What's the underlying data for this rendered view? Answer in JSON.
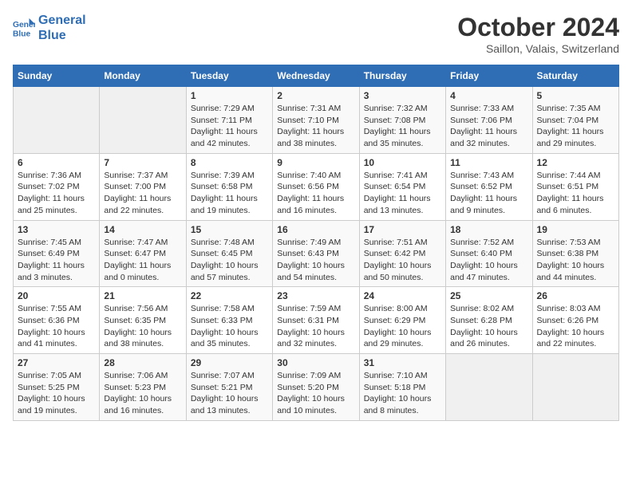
{
  "header": {
    "logo_line1": "General",
    "logo_line2": "Blue",
    "month": "October 2024",
    "location": "Saillon, Valais, Switzerland"
  },
  "weekdays": [
    "Sunday",
    "Monday",
    "Tuesday",
    "Wednesday",
    "Thursday",
    "Friday",
    "Saturday"
  ],
  "weeks": [
    [
      {
        "day": "",
        "empty": true
      },
      {
        "day": "",
        "empty": true
      },
      {
        "day": "1",
        "sunrise": "7:29 AM",
        "sunset": "7:11 PM",
        "daylight": "11 hours and 42 minutes."
      },
      {
        "day": "2",
        "sunrise": "7:31 AM",
        "sunset": "7:10 PM",
        "daylight": "11 hours and 38 minutes."
      },
      {
        "day": "3",
        "sunrise": "7:32 AM",
        "sunset": "7:08 PM",
        "daylight": "11 hours and 35 minutes."
      },
      {
        "day": "4",
        "sunrise": "7:33 AM",
        "sunset": "7:06 PM",
        "daylight": "11 hours and 32 minutes."
      },
      {
        "day": "5",
        "sunrise": "7:35 AM",
        "sunset": "7:04 PM",
        "daylight": "11 hours and 29 minutes."
      }
    ],
    [
      {
        "day": "6",
        "sunrise": "7:36 AM",
        "sunset": "7:02 PM",
        "daylight": "11 hours and 25 minutes."
      },
      {
        "day": "7",
        "sunrise": "7:37 AM",
        "sunset": "7:00 PM",
        "daylight": "11 hours and 22 minutes."
      },
      {
        "day": "8",
        "sunrise": "7:39 AM",
        "sunset": "6:58 PM",
        "daylight": "11 hours and 19 minutes."
      },
      {
        "day": "9",
        "sunrise": "7:40 AM",
        "sunset": "6:56 PM",
        "daylight": "11 hours and 16 minutes."
      },
      {
        "day": "10",
        "sunrise": "7:41 AM",
        "sunset": "6:54 PM",
        "daylight": "11 hours and 13 minutes."
      },
      {
        "day": "11",
        "sunrise": "7:43 AM",
        "sunset": "6:52 PM",
        "daylight": "11 hours and 9 minutes."
      },
      {
        "day": "12",
        "sunrise": "7:44 AM",
        "sunset": "6:51 PM",
        "daylight": "11 hours and 6 minutes."
      }
    ],
    [
      {
        "day": "13",
        "sunrise": "7:45 AM",
        "sunset": "6:49 PM",
        "daylight": "11 hours and 3 minutes."
      },
      {
        "day": "14",
        "sunrise": "7:47 AM",
        "sunset": "6:47 PM",
        "daylight": "11 hours and 0 minutes."
      },
      {
        "day": "15",
        "sunrise": "7:48 AM",
        "sunset": "6:45 PM",
        "daylight": "10 hours and 57 minutes."
      },
      {
        "day": "16",
        "sunrise": "7:49 AM",
        "sunset": "6:43 PM",
        "daylight": "10 hours and 54 minutes."
      },
      {
        "day": "17",
        "sunrise": "7:51 AM",
        "sunset": "6:42 PM",
        "daylight": "10 hours and 50 minutes."
      },
      {
        "day": "18",
        "sunrise": "7:52 AM",
        "sunset": "6:40 PM",
        "daylight": "10 hours and 47 minutes."
      },
      {
        "day": "19",
        "sunrise": "7:53 AM",
        "sunset": "6:38 PM",
        "daylight": "10 hours and 44 minutes."
      }
    ],
    [
      {
        "day": "20",
        "sunrise": "7:55 AM",
        "sunset": "6:36 PM",
        "daylight": "10 hours and 41 minutes."
      },
      {
        "day": "21",
        "sunrise": "7:56 AM",
        "sunset": "6:35 PM",
        "daylight": "10 hours and 38 minutes."
      },
      {
        "day": "22",
        "sunrise": "7:58 AM",
        "sunset": "6:33 PM",
        "daylight": "10 hours and 35 minutes."
      },
      {
        "day": "23",
        "sunrise": "7:59 AM",
        "sunset": "6:31 PM",
        "daylight": "10 hours and 32 minutes."
      },
      {
        "day": "24",
        "sunrise": "8:00 AM",
        "sunset": "6:29 PM",
        "daylight": "10 hours and 29 minutes."
      },
      {
        "day": "25",
        "sunrise": "8:02 AM",
        "sunset": "6:28 PM",
        "daylight": "10 hours and 26 minutes."
      },
      {
        "day": "26",
        "sunrise": "8:03 AM",
        "sunset": "6:26 PM",
        "daylight": "10 hours and 22 minutes."
      }
    ],
    [
      {
        "day": "27",
        "sunrise": "7:05 AM",
        "sunset": "5:25 PM",
        "daylight": "10 hours and 19 minutes."
      },
      {
        "day": "28",
        "sunrise": "7:06 AM",
        "sunset": "5:23 PM",
        "daylight": "10 hours and 16 minutes."
      },
      {
        "day": "29",
        "sunrise": "7:07 AM",
        "sunset": "5:21 PM",
        "daylight": "10 hours and 13 minutes."
      },
      {
        "day": "30",
        "sunrise": "7:09 AM",
        "sunset": "5:20 PM",
        "daylight": "10 hours and 10 minutes."
      },
      {
        "day": "31",
        "sunrise": "7:10 AM",
        "sunset": "5:18 PM",
        "daylight": "10 hours and 8 minutes."
      },
      {
        "day": "",
        "empty": true
      },
      {
        "day": "",
        "empty": true
      }
    ]
  ]
}
